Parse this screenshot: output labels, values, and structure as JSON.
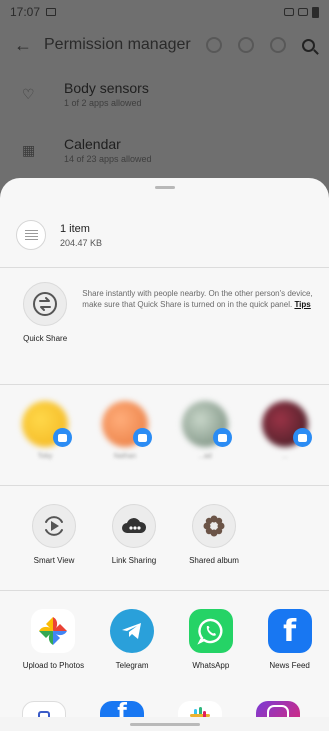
{
  "status_bar": {
    "time": "17:07"
  },
  "background_app": {
    "title": "Permission manager",
    "rows": [
      {
        "title": "Body sensors",
        "subtitle": "1 of 2 apps allowed",
        "icon": "heart-icon"
      },
      {
        "title": "Calendar",
        "subtitle": "14 of 23 apps allowed",
        "icon": "calendar-icon"
      }
    ]
  },
  "share_sheet": {
    "item_count": "1 item",
    "item_size": "204.47 KB",
    "quick_share": {
      "label": "Quick Share",
      "description": "Share instantly with people nearby. On the other person's device, make sure that Quick Share is turned on in the quick panel.",
      "tips": "Tips"
    },
    "contacts": [
      {
        "name": "Toby",
        "color": "#f4c430"
      },
      {
        "name": "Nathan",
        "color": "#f0955a"
      },
      {
        "name": "...ad",
        "color": "#8fa294"
      },
      {
        "name": "...",
        "color": "#6b2a38"
      }
    ],
    "utilities": [
      {
        "label": "Smart View",
        "icon": "smart-view-icon"
      },
      {
        "label": "Link Sharing",
        "icon": "link-sharing-icon"
      },
      {
        "label": "Shared album",
        "icon": "shared-album-icon"
      }
    ],
    "apps": [
      {
        "label": "Upload to Photos",
        "icon": "google-photos-icon"
      },
      {
        "label": "Telegram",
        "icon": "telegram-icon"
      },
      {
        "label": "WhatsApp",
        "icon": "whatsapp-icon"
      },
      {
        "label": "News Feed",
        "icon": "facebook-icon"
      }
    ]
  },
  "colors": {
    "accent_blue": "#2b8cf4",
    "scrim": "#6f6f6f",
    "sheet": "#f7f7f7"
  }
}
